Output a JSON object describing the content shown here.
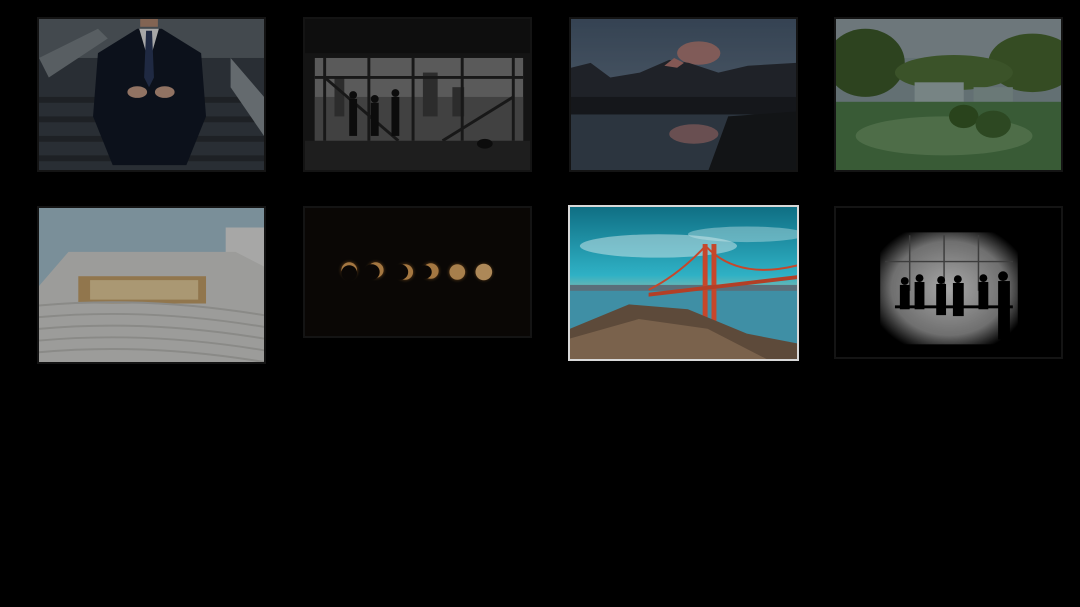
{
  "gallery": {
    "selected_index": 6,
    "photos": [
      {
        "icon": "businessman-suit-photo"
      },
      {
        "icon": "office-window-silhouettes-photo"
      },
      {
        "icon": "mountain-lake-reflection-photo"
      },
      {
        "icon": "green-waterfall-lagoon-photo"
      },
      {
        "icon": "white-amphitheater-architecture-photo"
      },
      {
        "icon": "eclipse-phases-photo"
      },
      {
        "icon": "golden-gate-bridge-photo"
      },
      {
        "icon": "people-silhouettes-window-photo"
      }
    ]
  }
}
